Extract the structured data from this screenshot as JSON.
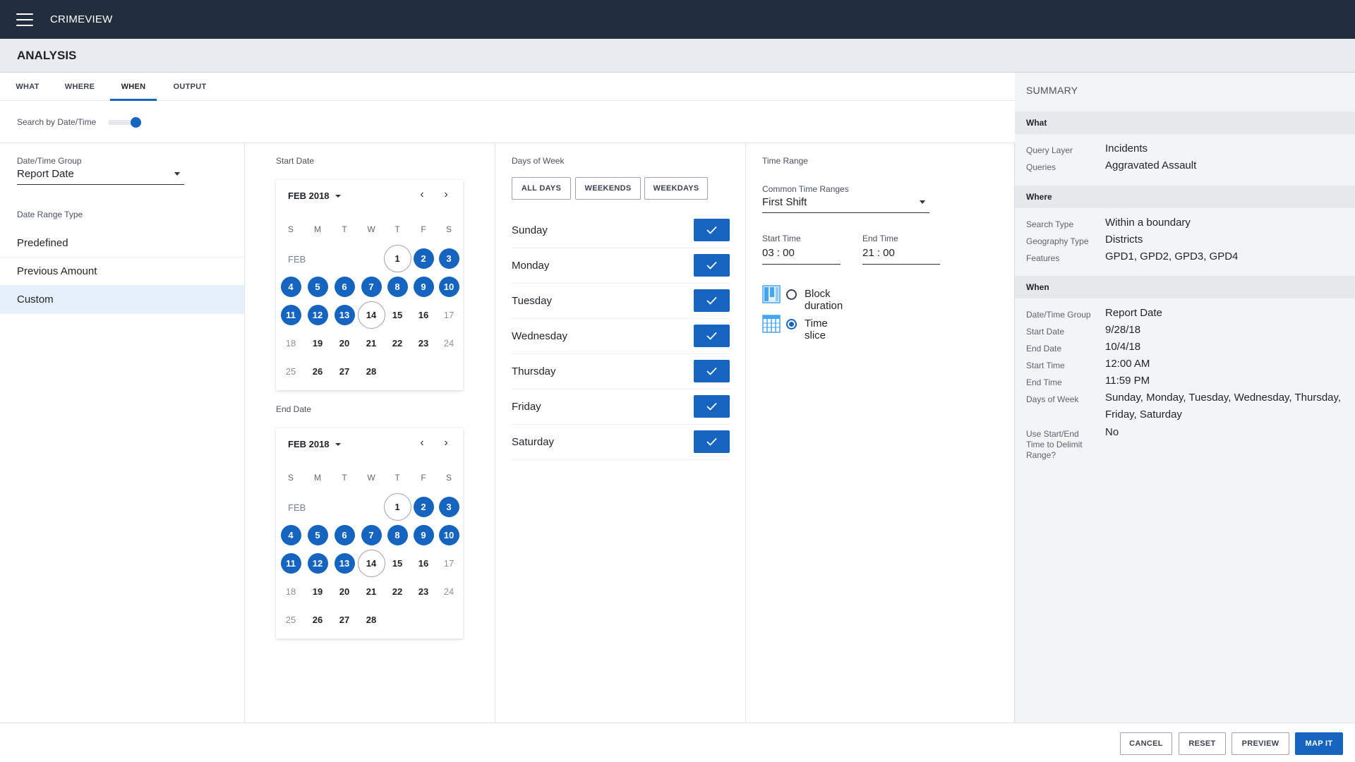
{
  "app": {
    "title": "CRIMEVIEW"
  },
  "page": {
    "title": "ANALYSIS"
  },
  "tabs": [
    {
      "label": "WHAT"
    },
    {
      "label": "WHERE"
    },
    {
      "label": "WHEN"
    },
    {
      "label": "OUTPUT"
    }
  ],
  "active_tab": "WHEN",
  "toggle": {
    "label": "Search by Date/Time",
    "on": true
  },
  "datetime_group": {
    "label": "Date/Time Group",
    "value": "Report Date"
  },
  "date_range_type": {
    "label": "Date Range Type",
    "options": [
      "Predefined",
      "Previous Amount",
      "Custom"
    ],
    "selected": "Custom"
  },
  "start_date": {
    "label": "Start Date",
    "month_label": "FEB 2018",
    "month_short": "FEB",
    "dow": [
      "S",
      "M",
      "T",
      "W",
      "T",
      "F",
      "S"
    ],
    "days": [
      "1",
      "2",
      "3",
      "4",
      "5",
      "6",
      "7",
      "8",
      "9",
      "10",
      "11",
      "12",
      "13",
      "14",
      "15",
      "16",
      "17",
      "18",
      "19",
      "20",
      "21",
      "22",
      "23",
      "24",
      "25",
      "26",
      "27",
      "28"
    ]
  },
  "end_date": {
    "label": "End Date",
    "month_label": "FEB 2018",
    "month_short": "FEB",
    "dow": [
      "S",
      "M",
      "T",
      "W",
      "T",
      "F",
      "S"
    ],
    "days": [
      "1",
      "2",
      "3",
      "4",
      "5",
      "6",
      "7",
      "8",
      "9",
      "10",
      "11",
      "12",
      "13",
      "14",
      "15",
      "16",
      "17",
      "18",
      "19",
      "20",
      "21",
      "22",
      "23",
      "24",
      "25",
      "26",
      "27",
      "28"
    ]
  },
  "days_of_week": {
    "label": "Days of Week",
    "buttons": [
      "ALL DAYS",
      "WEEKENDS",
      "WEEKDAYS"
    ],
    "days": [
      "Sunday",
      "Monday",
      "Tuesday",
      "Wednesday",
      "Thursday",
      "Friday",
      "Saturday"
    ]
  },
  "time_range": {
    "label": "Time Range",
    "common_label": "Common Time Ranges",
    "common_value": "First Shift",
    "start_label": "Start Time",
    "start_value": "03 : 00",
    "end_label": "End Time",
    "end_value": "21 : 00",
    "block_label": "Block duration",
    "slice_label": "Time slice",
    "selected": "Time slice"
  },
  "summary": {
    "title": "SUMMARY",
    "what_head": "What",
    "query_layer_key": "Query Layer",
    "query_layer_val": "Incidents",
    "queries_key": "Queries",
    "queries_val": "Aggravated Assault",
    "where_head": "Where",
    "search_type_key": "Search Type",
    "search_type_val": "Within a boundary",
    "geo_key": "Geography Type",
    "geo_val": "Districts",
    "features_key": "Features",
    "features_val": "GPD1, GPD2, GPD3, GPD4",
    "when_head": "When",
    "dtg_key": "Date/Time Group",
    "dtg_val": "Report Date",
    "start_date_key": "Start Date",
    "start_date_val": "9/28/18",
    "end_date_key": "End Date",
    "end_date_val": "10/4/18",
    "start_time_key": "Start Time",
    "start_time_val": "12:00 AM",
    "end_time_key": "End Time",
    "end_time_val": "11:59 PM",
    "dow_key": "Days of Week",
    "dow_val": "Sunday, Monday, Tuesday, Wednesday, Thursday, Friday, Saturday",
    "delimit_key": "Use Start/End Time to Delimit Range?",
    "delimit_val": "No"
  },
  "footer": {
    "cancel": "CANCEL",
    "reset": "RESET",
    "preview": "PREVIEW",
    "map_it": "MAP IT"
  },
  "colors": {
    "accent": "#1565c0",
    "topbar": "#222d3d"
  }
}
